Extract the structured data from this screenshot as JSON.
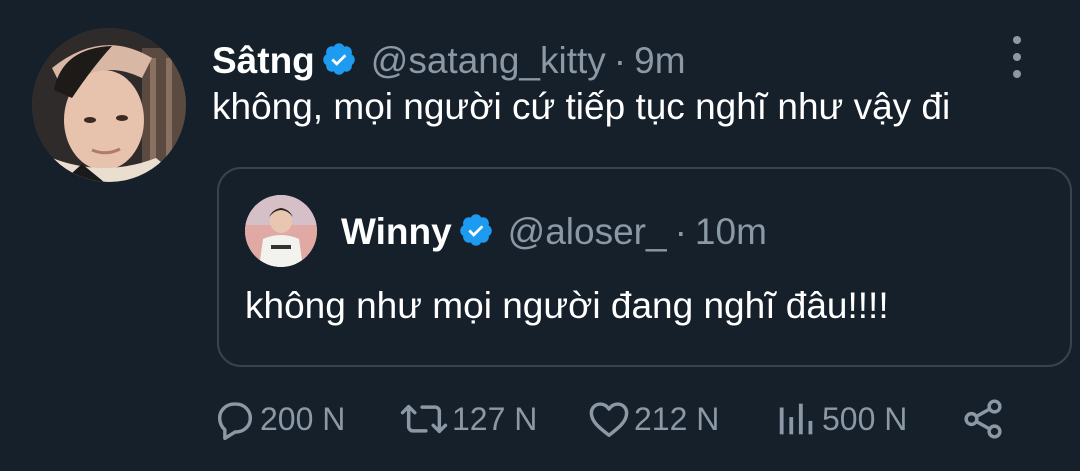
{
  "tweet": {
    "display_name": "Sâtng",
    "handle": "@satang_kitty",
    "separator": "·",
    "time": "9m",
    "text": "không, mọi người cứ tiếp tục nghĩ như vậy đi",
    "avatar_icon": "profile-photo",
    "verified_icon": "verified-badge-icon",
    "more_icon": "more-vertical-icon"
  },
  "quote": {
    "display_name": "Winny",
    "handle": "@aloser_",
    "separator": "·",
    "time": "10m",
    "text": "không như mọi người đang nghĩ đâu!!!!"
  },
  "actions": {
    "reply": {
      "icon": "reply-icon",
      "count": "200 N"
    },
    "retweet": {
      "icon": "retweet-icon",
      "count": "127 N"
    },
    "like": {
      "icon": "heart-icon",
      "count": "212 N"
    },
    "views": {
      "icon": "views-icon",
      "count": "500 N"
    },
    "share": {
      "icon": "share-icon"
    }
  },
  "colors": {
    "background": "#15202b",
    "text": "#ffffff",
    "secondary": "#8b98a5",
    "verified": "#1d9bf0",
    "border": "#38444d"
  }
}
